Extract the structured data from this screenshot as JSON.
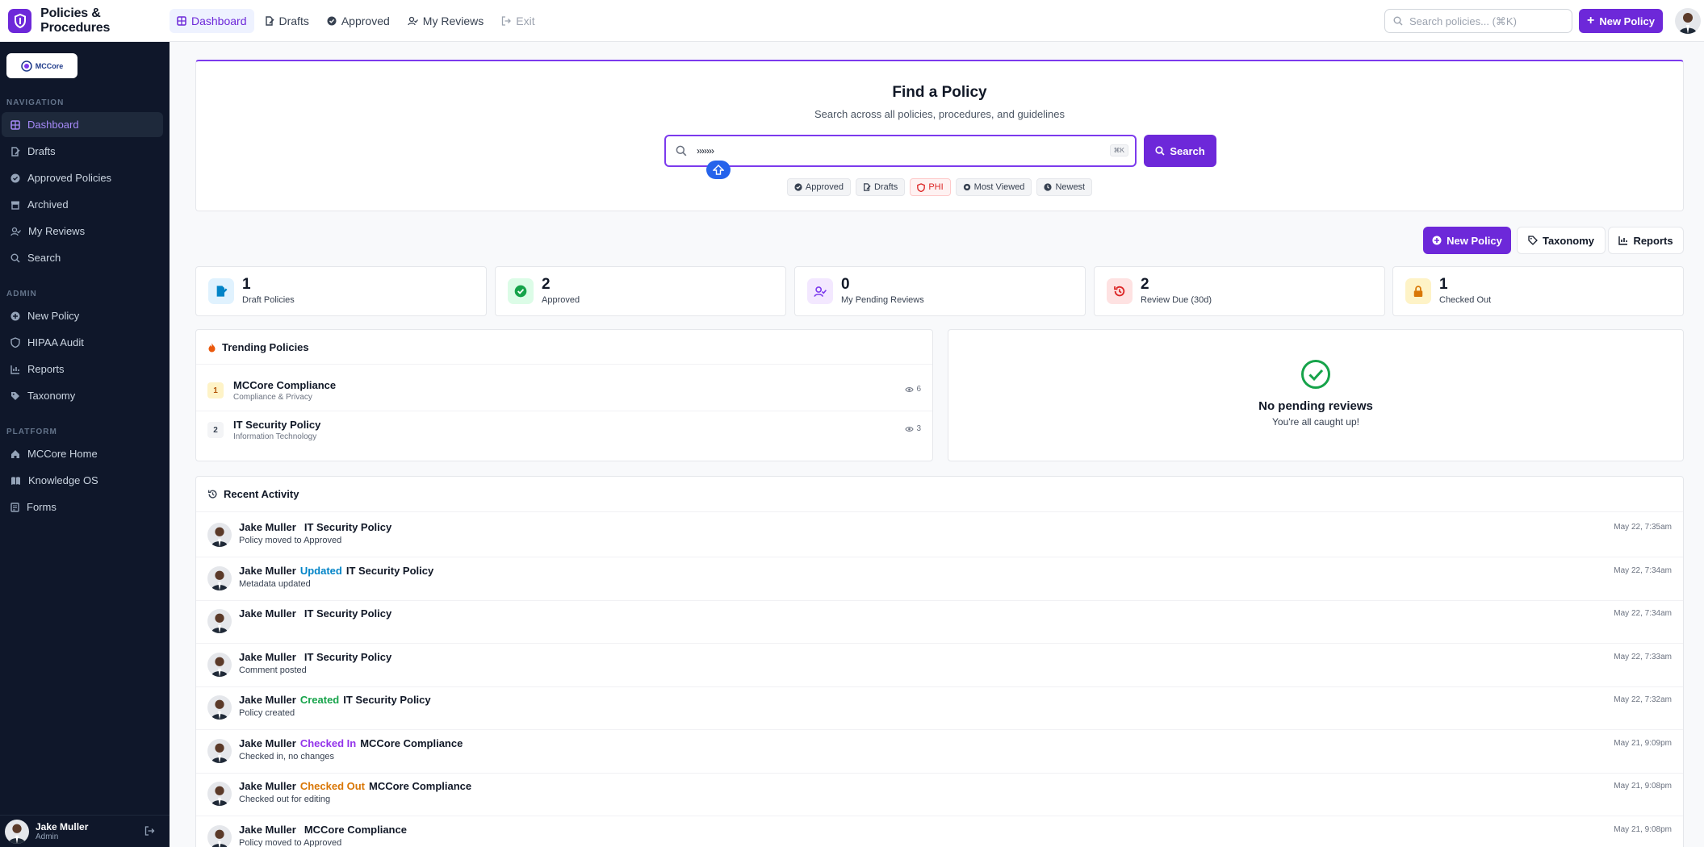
{
  "brand": {
    "title": "Policies & Procedures"
  },
  "topnav": [
    {
      "label": "Dashboard",
      "icon": "grid-icon"
    },
    {
      "label": "Drafts",
      "icon": "file-edit-icon"
    },
    {
      "label": "Approved",
      "icon": "check-circle-icon"
    },
    {
      "label": "My Reviews",
      "icon": "user-check-icon"
    },
    {
      "label": "Exit",
      "icon": "exit-icon"
    }
  ],
  "topbar": {
    "search_placeholder": "Search policies... (⌘K)",
    "new_policy_label": "New Policy"
  },
  "sidebar": {
    "org_logo_text": "MCCore",
    "sections": [
      {
        "title": "NAVIGATION",
        "items": [
          {
            "label": "Dashboard",
            "icon": "grid-icon"
          },
          {
            "label": "Drafts",
            "icon": "file-edit-icon"
          },
          {
            "label": "Approved Policies",
            "icon": "check-circle-icon"
          },
          {
            "label": "Archived",
            "icon": "archive-icon"
          },
          {
            "label": "My Reviews",
            "icon": "user-check-icon"
          },
          {
            "label": "Search",
            "icon": "search-icon"
          }
        ]
      },
      {
        "title": "ADMIN",
        "items": [
          {
            "label": "New Policy",
            "icon": "plus-circle-icon"
          },
          {
            "label": "HIPAA Audit",
            "icon": "shield-icon"
          },
          {
            "label": "Reports",
            "icon": "chart-icon"
          },
          {
            "label": "Taxonomy",
            "icon": "tag-icon"
          }
        ]
      },
      {
        "title": "PLATFORM",
        "items": [
          {
            "label": "MCCore Home",
            "icon": "home-icon"
          },
          {
            "label": "Knowledge OS",
            "icon": "book-icon"
          },
          {
            "label": "Forms",
            "icon": "form-icon"
          }
        ]
      }
    ],
    "user": {
      "name": "Jake Muller",
      "role": "Admin"
    }
  },
  "find": {
    "title": "Find a Policy",
    "subtitle": "Search across all policies, procedures, and guidelines",
    "input_value": "›››››››",
    "kbd": "⌘K",
    "search_label": "Search",
    "filters": [
      {
        "label": "Approved",
        "icon": "check-circle-icon"
      },
      {
        "label": "Drafts",
        "icon": "file-edit-icon"
      },
      {
        "label": "PHI",
        "icon": "shield-icon"
      },
      {
        "label": "Most Viewed",
        "icon": "eye-icon"
      },
      {
        "label": "Newest",
        "icon": "clock-icon"
      }
    ]
  },
  "actions": {
    "new_policy": "New Policy",
    "taxonomy": "Taxonomy",
    "reports": "Reports"
  },
  "stats": [
    {
      "value": "1",
      "label": "Draft Policies",
      "icon": "file-edit-icon",
      "color": "#0284c7",
      "bg": "#e0f2fe"
    },
    {
      "value": "2",
      "label": "Approved",
      "icon": "check-circle-icon",
      "color": "#16a34a",
      "bg": "#dcfce7"
    },
    {
      "value": "0",
      "label": "My Pending Reviews",
      "icon": "user-check-icon",
      "color": "#7c3aed",
      "bg": "#f3e8ff"
    },
    {
      "value": "2",
      "label": "Review Due (30d)",
      "icon": "history-icon",
      "color": "#dc2626",
      "bg": "#fee2e2"
    },
    {
      "value": "1",
      "label": "Checked Out",
      "icon": "lock-icon",
      "color": "#d97706",
      "bg": "#fef3c7"
    }
  ],
  "trending": {
    "title": "Trending Policies",
    "items": [
      {
        "rank": "1",
        "name": "MCCore Compliance",
        "category": "Compliance & Privacy",
        "views": "6"
      },
      {
        "rank": "2",
        "name": "IT Security Policy",
        "category": "Information Technology",
        "views": "3"
      }
    ]
  },
  "pending": {
    "title": "No pending reviews",
    "subtitle": "You're all caught up!"
  },
  "activity": {
    "title": "Recent Activity",
    "items": [
      {
        "user": "Jake Muller",
        "action": "",
        "policy": "IT Security Policy",
        "detail": "Policy moved to Approved",
        "time": "May 22, 7:35am"
      },
      {
        "user": "Jake Muller",
        "action": "Updated",
        "action_color": "#0284c7",
        "policy": "IT Security Policy",
        "detail": "Metadata updated",
        "time": "May 22, 7:34am"
      },
      {
        "user": "Jake Muller",
        "action": "",
        "policy": "IT Security Policy",
        "detail": "",
        "time": "May 22, 7:34am"
      },
      {
        "user": "Jake Muller",
        "action": "",
        "policy": "IT Security Policy",
        "detail": "Comment posted",
        "time": "May 22, 7:33am"
      },
      {
        "user": "Jake Muller",
        "action": "Created",
        "action_color": "#16a34a",
        "policy": "IT Security Policy",
        "detail": "Policy created",
        "time": "May 22, 7:32am"
      },
      {
        "user": "Jake Muller",
        "action": "Checked In",
        "action_color": "#9333ea",
        "policy": "MCCore Compliance",
        "detail": "Checked in, no changes",
        "time": "May 21, 9:09pm"
      },
      {
        "user": "Jake Muller",
        "action": "Checked Out",
        "action_color": "#d97706",
        "policy": "MCCore Compliance",
        "detail": "Checked out for editing",
        "time": "May 21, 9:08pm"
      },
      {
        "user": "Jake Muller",
        "action": "",
        "policy": "MCCore Compliance",
        "detail": "Policy moved to Approved",
        "time": "May 21, 9:08pm"
      }
    ]
  },
  "colors": {
    "accent": "#6d28d9",
    "sidebar_bg": "#0f172a",
    "active_text": "#a78bfa"
  }
}
